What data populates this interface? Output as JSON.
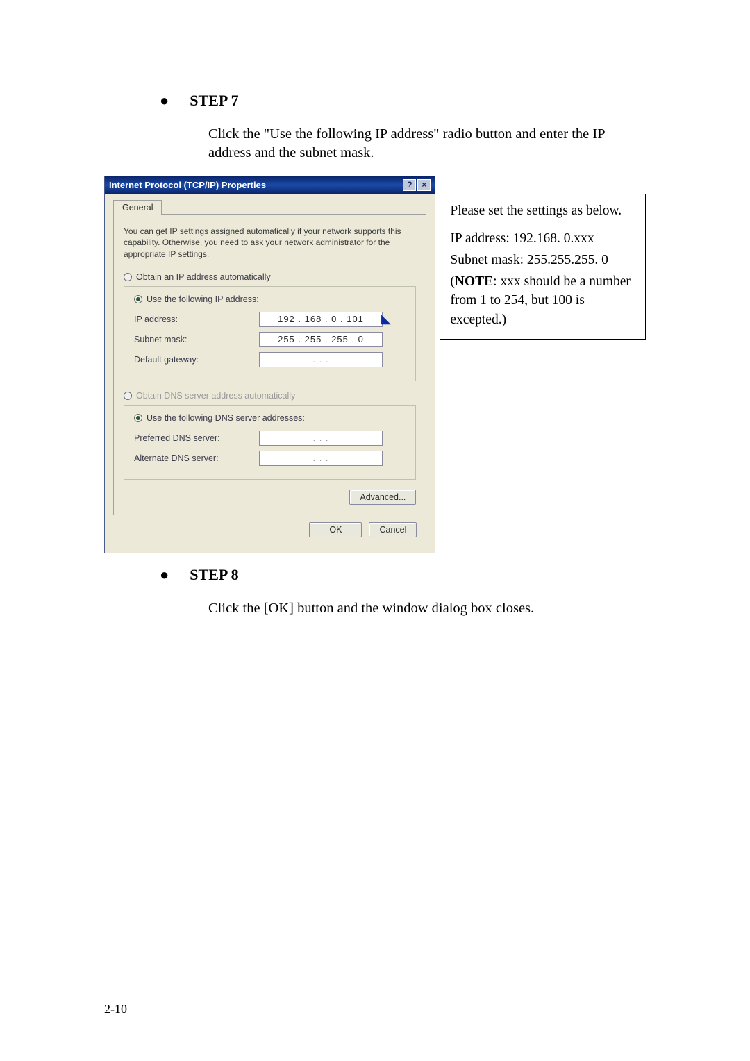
{
  "step7": {
    "title": "STEP 7",
    "body": "Click the \"Use the following IP address\" radio button and enter the IP address and the subnet mask."
  },
  "dialog": {
    "title": "Internet Protocol (TCP/IP) Properties",
    "help_icon": "?",
    "close_icon": "×",
    "tab": "General",
    "description": "You can get IP settings assigned automatically if your network supports this capability. Otherwise, you need to ask your network administrator for the appropriate IP settings.",
    "radio_auto": "Obtain an IP address automatically",
    "radio_manual": "Use the following IP address:",
    "ip_label": "IP address:",
    "ip_value": "192 . 168 .  0  . 101",
    "subnet_label": "Subnet mask:",
    "subnet_value": "255 . 255 . 255 .  0",
    "gateway_label": "Default gateway:",
    "gateway_value": ".     .     .",
    "dns_auto": "Obtain DNS server address automatically",
    "dns_manual": "Use the following DNS server addresses:",
    "pref_dns_label": "Preferred DNS server:",
    "pref_dns_value": ".     .     .",
    "alt_dns_label": "Alternate DNS server:",
    "alt_dns_value": ".     .     .",
    "advanced_btn": "Advanced...",
    "ok_btn": "OK",
    "cancel_btn": "Cancel"
  },
  "note": {
    "l1": "Please set the settings as below.",
    "l2a": "IP address: ",
    "l2b": "192.168. 0.xxx",
    "l3a": "Subnet mask: ",
    "l3b": "255.255.255.   0",
    "l4a": "(",
    "l4b": "NOTE",
    "l4c": ": xxx should be a number from 1 to 254, but 100 is excepted.)"
  },
  "step8": {
    "title": "STEP 8",
    "body": "Click the [OK] button and the window dialog box closes."
  },
  "page_num": "2-10"
}
